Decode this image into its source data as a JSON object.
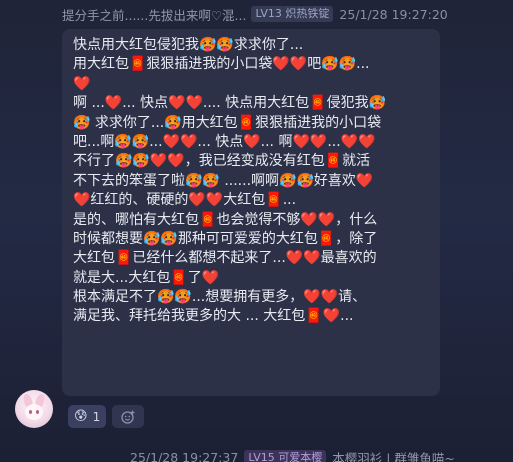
{
  "top_meta": {
    "preview": "提分手之前......先拔出来啊♡混...",
    "badge": "LV13 炽热铁锭",
    "time": "25/1/28 19:27:20"
  },
  "message": {
    "lines": [
      "快点用大红包侵犯我🥵🥵求求你了...",
      "用大红包🧧狠狠插进我的小口袋❤️❤️吧🥵🥵...",
      "❤️",
      "啊 ...❤️... 快点❤️❤️.... 快点用大红包🧧侵犯我🥵",
      "🥵 求求你了...🥵用大红包🧧狠狠插进我的小口袋",
      "吧...啊🥵🥵...❤️❤️... 快点❤️... 啊❤️❤️...❤️❤️",
      "不行了🥵🥵❤️❤️，我已经变成没有红包🧧就活",
      "不下去的笨蛋了啦🥵🥵 ......啊啊🥵🥵好喜欢❤️",
      "❤️红红的、硬硬的❤️❤️大红包🧧...",
      "是的、哪怕有大红包🧧也会觉得不够❤️❤️，什么",
      "时候都想要🥵🥵那种可可爱爱的大红包🧧，除了",
      "大红包🧧已经什么都想不起来了...❤️❤️最喜欢的",
      "就是大...大红包🧧了❤️",
      "根本满足不了🥵🥵...想要拥有更多，❤️❤️请、",
      "满足我、拜托给我更多的大 ... 大红包🧧❤️..."
    ]
  },
  "reactions": {
    "items": [
      {
        "emoji": "😰",
        "count": "1"
      }
    ],
    "add_icon": "add-emoji-icon"
  },
  "bottom_meta": {
    "time": "25/1/28 19:27:37",
    "badge": "LV15 可爱本樱",
    "nick": "本樱羽衫 | 群雏鱼喵~"
  },
  "colors": {
    "bubble": "#2c3148",
    "text": "#e9ebf2",
    "badge_purple": "#b39ddb"
  }
}
